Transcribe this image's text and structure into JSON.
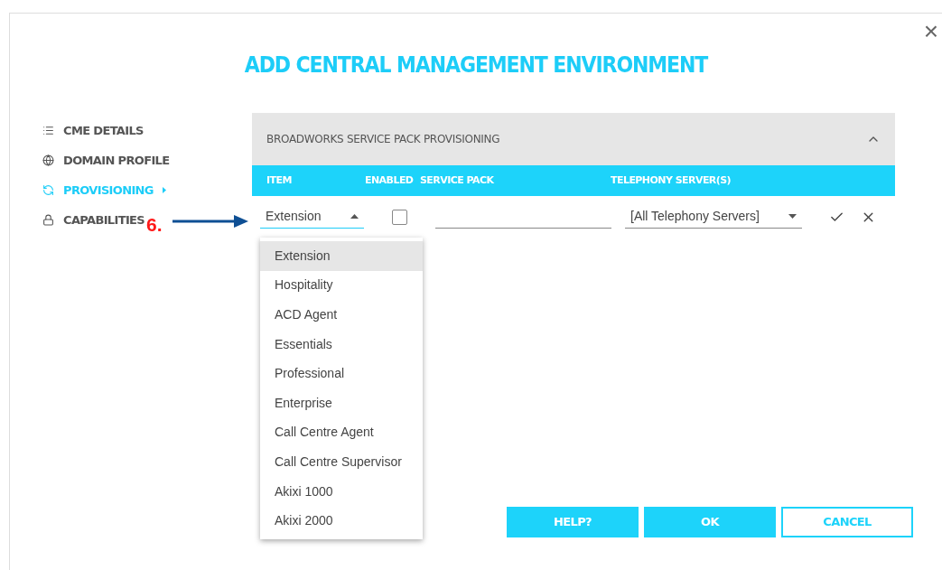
{
  "dialog": {
    "title": "ADD CENTRAL MANAGEMENT ENVIRONMENT",
    "close": "×"
  },
  "sidebar": {
    "items": [
      {
        "label": "CME DETAILS",
        "kind": "details",
        "selected": false
      },
      {
        "label": "DOMAIN PROFILE",
        "kind": "domain",
        "selected": false
      },
      {
        "label": "PROVISIONING",
        "kind": "provisioning",
        "selected": true
      },
      {
        "label": "CAPABILITIES",
        "kind": "capabilities",
        "selected": false
      }
    ]
  },
  "annotation": {
    "label": "6."
  },
  "panel": {
    "title": "BROADWORKS SERVICE PACK PROVISIONING",
    "expanded": true,
    "columns": [
      "ITEM",
      "ENABLED",
      "SERVICE PACK",
      "TELEPHONY SERVER(S)"
    ],
    "row": {
      "item": "Extension",
      "enabled": false,
      "server": "[All Telephony Servers]"
    }
  },
  "dropdown": {
    "options": [
      {
        "label": "Extension",
        "selected": true
      },
      {
        "label": "Hospitality",
        "selected": false
      },
      {
        "label": "ACD Agent",
        "selected": false
      },
      {
        "label": "Essentials",
        "selected": false
      },
      {
        "label": "Professional",
        "selected": false
      },
      {
        "label": "Enterprise",
        "selected": false
      },
      {
        "label": "Call Centre Agent",
        "selected": false
      },
      {
        "label": "Call Centre Supervisor",
        "selected": false
      },
      {
        "label": "Akixi 1000",
        "selected": false
      },
      {
        "label": "Akixi 2000",
        "selected": false
      }
    ]
  },
  "buttons": [
    {
      "label": "HELP?",
      "kind": "filled"
    },
    {
      "label": "OK",
      "kind": "filled"
    },
    {
      "label": "CANCEL",
      "kind": "outline"
    }
  ]
}
